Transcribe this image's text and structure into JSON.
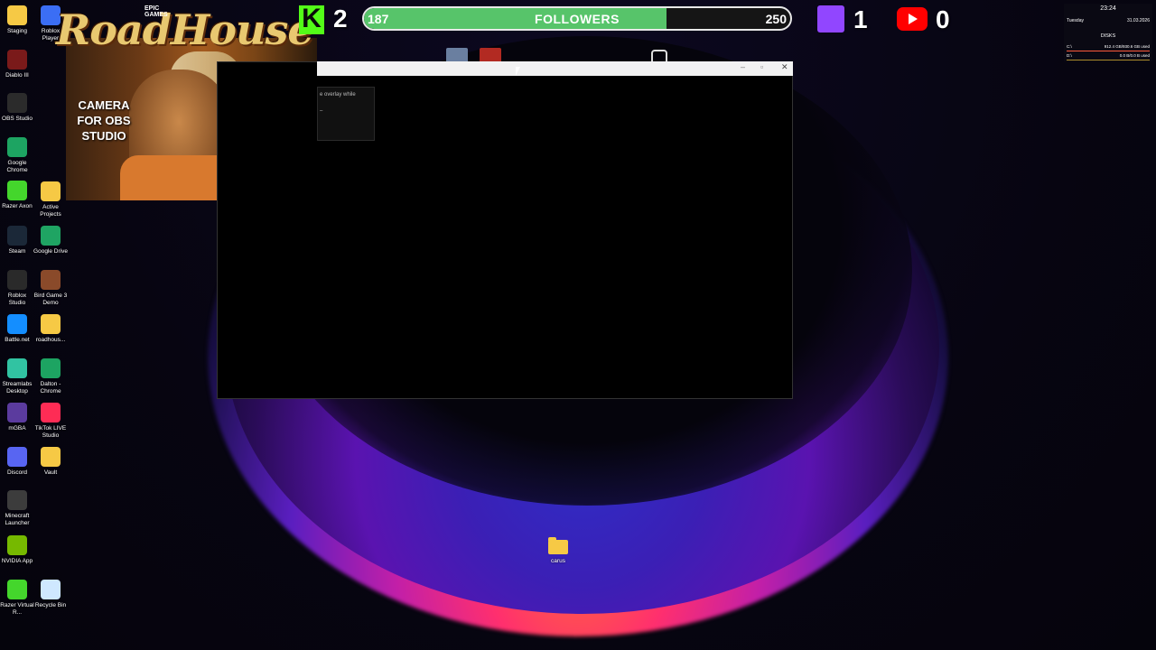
{
  "desktop_icons_col1": [
    {
      "label": "Staging",
      "icon": "folder-icon",
      "color": "#f6c945"
    },
    {
      "label": "Diablo III",
      "icon": "diablo-icon",
      "color": "#7a1a1a"
    },
    {
      "label": "OBS Studio",
      "icon": "obs-icon",
      "color": "#2b2b2b"
    },
    {
      "label": "Google Chrome",
      "icon": "chrome-icon",
      "color": "#1da462"
    },
    {
      "label": "Razer Axon",
      "icon": "razer-axon-icon",
      "color": "#44d62c"
    },
    {
      "label": "Steam",
      "icon": "steam-icon",
      "color": "#1b2838"
    },
    {
      "label": "Roblox Studio",
      "icon": "roblox-studio-icon",
      "color": "#2a2a2a"
    },
    {
      "label": "Battle.net",
      "icon": "battlenet-icon",
      "color": "#148eff"
    },
    {
      "label": "Streamlabs Desktop",
      "icon": "streamlabs-icon",
      "color": "#31c3a2"
    },
    {
      "label": "mGBA",
      "icon": "mgba-icon",
      "color": "#5b3b9e"
    },
    {
      "label": "Discord",
      "icon": "discord-icon",
      "color": "#5865f2"
    },
    {
      "label": "Minecraft Launcher",
      "icon": "minecraft-icon",
      "color": "#3c3c3c"
    },
    {
      "label": "NVIDIA App",
      "icon": "nvidia-icon",
      "color": "#76b900"
    },
    {
      "label": "Razer Virtual R...",
      "icon": "razer-icon",
      "color": "#44d62c"
    }
  ],
  "desktop_icons_col2": [
    {
      "label": "Roblox Player",
      "icon": "roblox-icon",
      "color": "#3b6ef5"
    },
    {
      "label": "Active Projects",
      "icon": "folder-icon",
      "color": "#f6c945"
    },
    {
      "label": "Google Drive",
      "icon": "drive-icon",
      "color": "#1fa463"
    },
    {
      "label": "Bird Game 3 Demo",
      "icon": "bird-game-icon",
      "color": "#8a4a2a"
    },
    {
      "label": "roadhous...",
      "icon": "folder-icon",
      "color": "#f6c945"
    },
    {
      "label": "Dalton - Chrome",
      "icon": "chrome-icon",
      "color": "#1da462"
    },
    {
      "label": "TikTok LIVE Studio",
      "icon": "tiktok-icon",
      "color": "#fe2c55"
    },
    {
      "label": "Vault",
      "icon": "folder-icon",
      "color": "#f6c945"
    },
    {
      "label": "Recycle Bin",
      "icon": "recycle-bin-icon",
      "color": "#cfe8ff"
    }
  ],
  "overlay": {
    "kick_letter": "K",
    "kick_count": "2",
    "followers_current": "187",
    "followers_label": "FOLLOWERS",
    "followers_goal": "250",
    "followers_progress": 0.71,
    "twitch_count": "1",
    "youtube_count": "0"
  },
  "camera": {
    "label": "CAMERA FOR OBS STUDIO",
    "logo": "RoadHouse",
    "epic_text_1": "EPIC",
    "epic_text_2": "GAMES"
  },
  "window": {
    "tooltip_text": "e overlay while",
    "tooltip_sub": "–",
    "minimize": "–",
    "maximize": "▫",
    "close": "✕"
  },
  "disks_widget": {
    "time": "23:24",
    "day": "Tuesday",
    "date": "31.03.2026",
    "title": "DISKS",
    "drive1_label": "C:\\",
    "drive1_value": "912.4 GB/930.6 GB used",
    "drive2_label": "D:\\",
    "drive2_value": "0.0 B/0.0 B used"
  },
  "desktop_folder": {
    "label": "carus"
  }
}
